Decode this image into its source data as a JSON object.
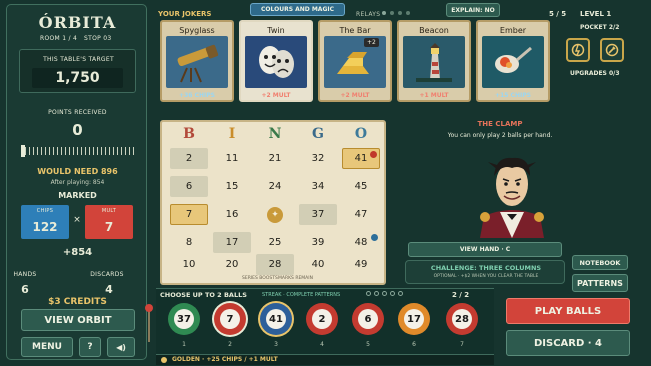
{
  "left": {
    "title": "ÓRBITA",
    "room": "ROOM 1 / 4",
    "stop": "STOP 03",
    "target_label": "THIS TABLE'S TARGET",
    "target": "1,750",
    "points_label": "POINTS RECEIVED",
    "points": "0",
    "need": "WOULD NEED 896",
    "after": "After playing: 854",
    "marked": "MARKED",
    "chips_label": "CHIPS",
    "chips": "122",
    "times": "×",
    "mult_label": "MULT",
    "mult": "7",
    "plus": "+854",
    "hands_label": "HANDS",
    "hands": "6",
    "discards_label": "DISCARDS",
    "discards": "4",
    "credits": "$3 CREDITS",
    "view_orbit": "VIEW ORBIT",
    "menu": "MENU",
    "help": "?",
    "sound": "◀)"
  },
  "top": {
    "your_jokers": "YOUR JOKERS",
    "colours_tab": "COLOURS AND MAGIC",
    "relays": "RELAYS",
    "explain": "EXPLAIN: NO",
    "counter": "5 / 5",
    "level": "LEVEL 1",
    "pocket": "POCKET 2/2",
    "upgrades": "UPGRADES 0/3"
  },
  "jokers": [
    {
      "name": "Spyglass",
      "bonus": "+36 CHIPS",
      "bg": "#3b6a8a"
    },
    {
      "name": "Twin",
      "bonus": "+2 MULT",
      "bg": "#294a7a"
    },
    {
      "name": "The Bar",
      "bonus": "+2 MULT",
      "bg": "#3b6a8a",
      "badge": "+2"
    },
    {
      "name": "Beacon",
      "bonus": "+1 MULT",
      "bg": "#2a5a6a"
    },
    {
      "name": "Ember",
      "bonus": "+15 CHIPS",
      "bg": "#1f5a66"
    }
  ],
  "card": {
    "letters": [
      "B",
      "I",
      "N",
      "G",
      "O"
    ],
    "letter_colors": [
      "#b24a3a",
      "#c98d2a",
      "#3a7a4a",
      "#3a6a8a",
      "#3d7a9a"
    ],
    "rows": [
      [
        "2",
        "11",
        "21",
        "32",
        "41"
      ],
      [
        "6",
        "15",
        "24",
        "34",
        "45"
      ],
      [
        "7",
        "16",
        "✦",
        "37",
        "47"
      ],
      [
        "8",
        "17",
        "25",
        "39",
        "48"
      ],
      [
        "10",
        "20",
        "28",
        "40",
        "49"
      ]
    ],
    "footer_left": "SERIES BOOSTS",
    "footer_right": "MARKS REMAIN"
  },
  "clamp": {
    "title": "THE CLAMP",
    "desc": "You can only play 2 balls per hand."
  },
  "controls": {
    "view_hand": "VIEW HAND · C",
    "challenge": "CHALLENGE: THREE COLUMNS",
    "optional": "OPTIONAL · +$2 WHEN YOU CLEAR THE TABLE",
    "notebook": "NOTEBOOK",
    "patterns": "PATTERNS",
    "play": "PLAY BALLS",
    "discard": "DISCARD · 4"
  },
  "tray": {
    "choose": "CHOOSE UP TO 2 BALLS",
    "streak": "STREAK · COMPLETE PATTERNS",
    "count": "2 / 2",
    "footer": "GOLDEN · +25 CHIPS / +1 MULT",
    "balls": [
      {
        "n": "37",
        "idx": "1",
        "color": "#2f8a52"
      },
      {
        "n": "7",
        "idx": "2",
        "color": "#c43b30"
      },
      {
        "n": "41",
        "idx": "3",
        "color": "#2d5f9a"
      },
      {
        "n": "2",
        "idx": "4",
        "color": "#c43b30"
      },
      {
        "n": "6",
        "idx": "5",
        "color": "#c43b30"
      },
      {
        "n": "17",
        "idx": "6",
        "color": "#e08a2a"
      },
      {
        "n": "28",
        "idx": "7",
        "color": "#c43b30"
      }
    ]
  }
}
